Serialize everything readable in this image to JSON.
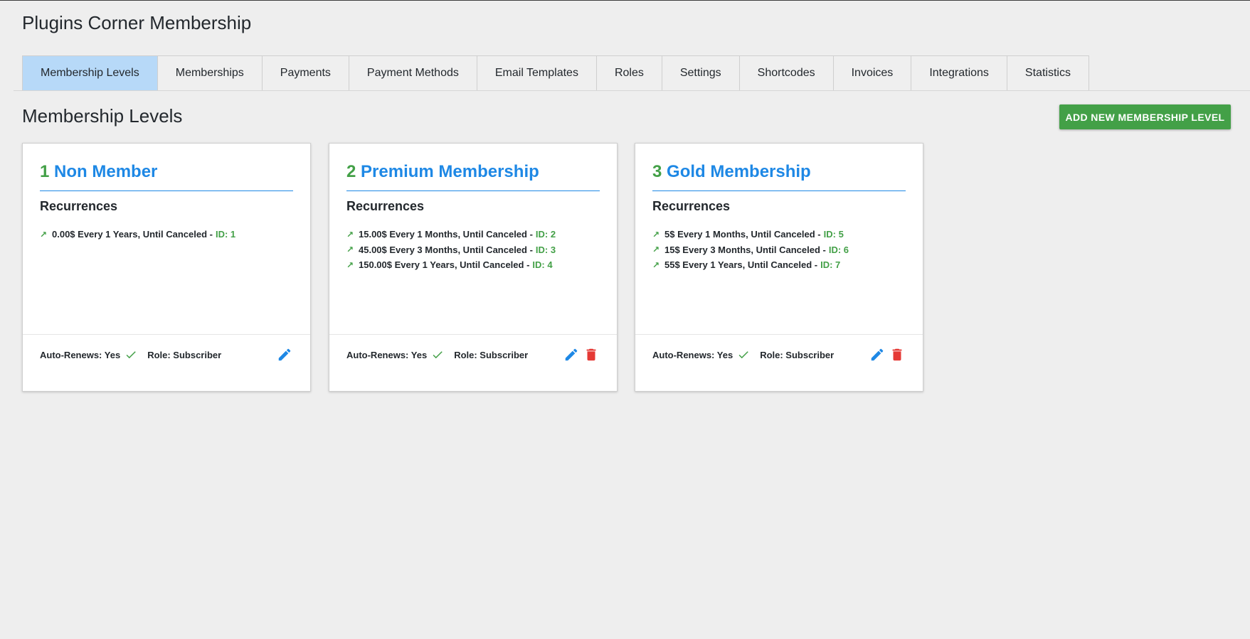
{
  "app": {
    "title": "Plugins Corner Membership"
  },
  "tabs": [
    {
      "label": "Membership Levels",
      "active": true
    },
    {
      "label": "Memberships",
      "active": false
    },
    {
      "label": "Payments",
      "active": false
    },
    {
      "label": "Payment Methods",
      "active": false
    },
    {
      "label": "Email Templates",
      "active": false
    },
    {
      "label": "Roles",
      "active": false
    },
    {
      "label": "Settings",
      "active": false
    },
    {
      "label": "Shortcodes",
      "active": false
    },
    {
      "label": "Invoices",
      "active": false
    },
    {
      "label": "Integrations",
      "active": false
    },
    {
      "label": "Statistics",
      "active": false
    }
  ],
  "main": {
    "title": "Membership Levels",
    "add_button": "ADD NEW MEMBERSHIP LEVEL"
  },
  "cards": [
    {
      "num": "1",
      "name": "Non Member",
      "recurrences_title": "Recurrences",
      "recurrences": [
        {
          "text": "0.00$ Every 1 Years, Until Canceled -",
          "id": "ID: 1"
        }
      ],
      "auto_renews": "Auto-Renews: Yes",
      "role": "Role: Subscriber",
      "can_delete": false
    },
    {
      "num": "2",
      "name": "Premium Membership",
      "recurrences_title": "Recurrences",
      "recurrences": [
        {
          "text": "15.00$ Every 1 Months, Until Canceled -",
          "id": "ID: 2"
        },
        {
          "text": "45.00$ Every 3 Months, Until Canceled -",
          "id": "ID: 3"
        },
        {
          "text": "150.00$ Every 1 Years, Until Canceled -",
          "id": "ID: 4"
        }
      ],
      "auto_renews": "Auto-Renews: Yes",
      "role": "Role: Subscriber",
      "can_delete": true
    },
    {
      "num": "3",
      "name": "Gold Membership",
      "recurrences_title": "Recurrences",
      "recurrences": [
        {
          "text": "5$ Every 1 Months, Until Canceled -",
          "id": "ID: 5"
        },
        {
          "text": "15$ Every 3 Months, Until Canceled -",
          "id": "ID: 6"
        },
        {
          "text": "55$ Every 1 Years, Until Canceled -",
          "id": "ID: 7"
        }
      ],
      "auto_renews": "Auto-Renews: Yes",
      "role": "Role: Subscriber",
      "can_delete": true
    }
  ],
  "icons": {
    "arrow": "north-east-arrow-icon",
    "check": "check-icon",
    "edit": "pencil-icon",
    "delete": "trash-icon"
  },
  "colors": {
    "accent_blue": "#1e88e5",
    "accent_green": "#43a047",
    "delete_red": "#e53935",
    "active_tab": "#b7d9f8"
  }
}
